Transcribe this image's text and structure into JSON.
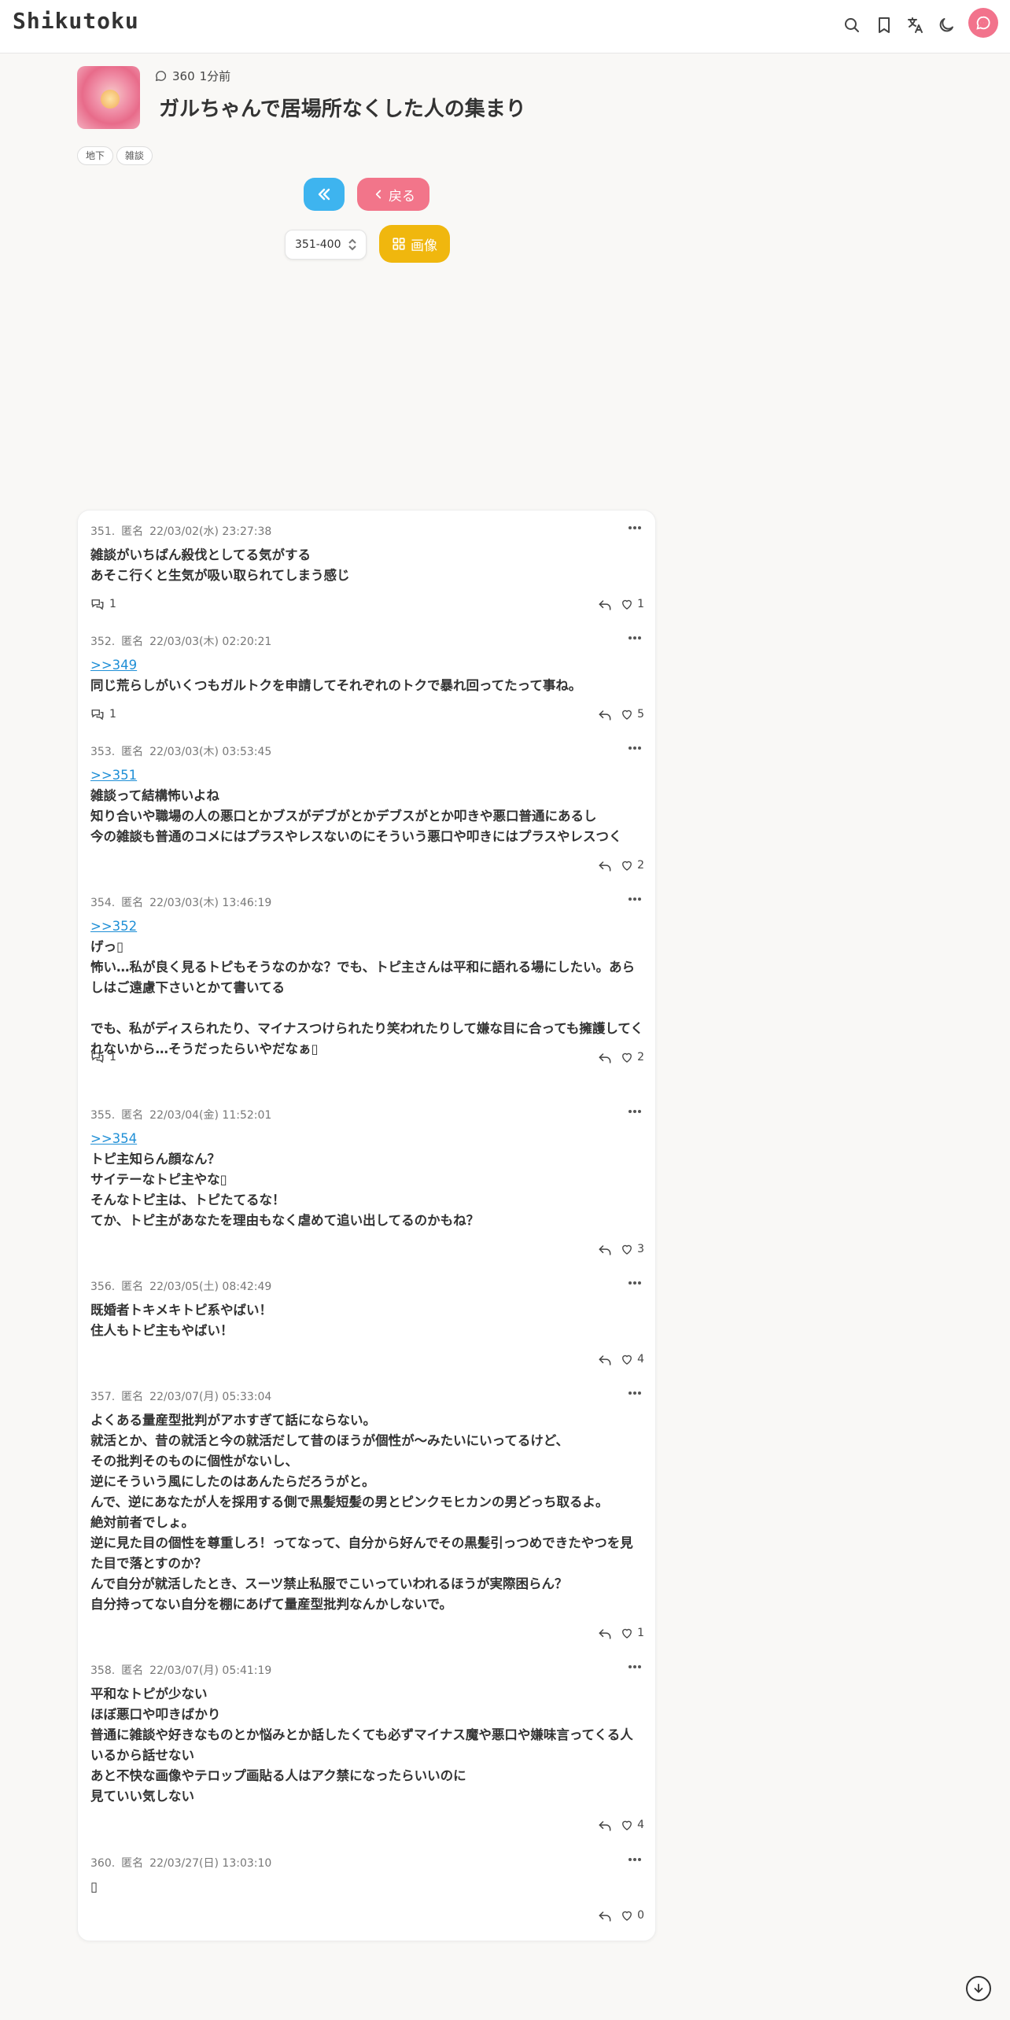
{
  "header": {
    "logo": "Shikutoku",
    "icons": [
      "search-icon",
      "bookmark-icon",
      "translate-icon",
      "moon-icon",
      "chat-icon"
    ]
  },
  "topic": {
    "comment_count": "360",
    "time_ago": "1分前",
    "title": "ガルちゃんで居場所なくした人の集まり",
    "tags": [
      "地下",
      "雑談"
    ]
  },
  "nav": {
    "back_label": "戻る",
    "page_range": "351-400",
    "image_label": "画像"
  },
  "colors": {
    "first_button": "#3eb4ef",
    "back_button": "#f2758a",
    "image_button": "#f0b70e",
    "link": "#1f8fd6"
  },
  "posts": [
    {
      "num": "351.",
      "name": "匿名",
      "date": "22/03/02(水) 23:27:38",
      "lines": [
        "雑談がいちばん殺伐としてる気がする",
        "あそこ行くと生気が吸い取られてしまう感じ"
      ],
      "reply_count": "1",
      "likes": "1"
    },
    {
      "num": "352.",
      "name": "匿名",
      "date": "22/03/03(木) 02:20:21",
      "reply_to": ">>349",
      "lines": [
        "同じ荒らしがいくつもガルトクを申請してそれぞれのトクで暴れ回ってたって事ね。"
      ],
      "reply_count": "1",
      "likes": "5"
    },
    {
      "num": "353.",
      "name": "匿名",
      "date": "22/03/03(木) 03:53:45",
      "reply_to": ">>351",
      "lines": [
        "雑談って結構怖いよね",
        "知り合いや職場の人の悪口とかブスがデブがとかデブスがとか叩きや悪口普通にあるし",
        "今の雑談も普通のコメにはプラスやレスないのにそういう悪口や叩きにはプラスやレスつく"
      ],
      "likes": "2"
    },
    {
      "num": "354.",
      "name": "匿名",
      "date": "22/03/03(木) 13:46:19",
      "reply_to": ">>352",
      "lines": [
        "げっ▯",
        "怖い…私が良く見るトピもそうなのかな？でも、トピ主さんは平和に語れる場にしたい。あらしはご遠慮下さいとかて書いてる",
        "",
        "でも、私がディスられたり、マイナスつけられたり笑われたりして嫌な目に合っても擁護してくれないから…そうだったらいやだなぁ▯"
      ],
      "reply_count": "1",
      "likes": "2"
    },
    {
      "num": "355.",
      "name": "匿名",
      "date": "22/03/04(金) 11:52:01",
      "reply_to": ">>354",
      "lines": [
        "トピ主知らん顔なん？",
        "サイテーなトピ主やな▯",
        "そんなトピ主は、トピたてるな！",
        "てか、トピ主があなたを理由もなく虐めて追い出してるのかもね？"
      ],
      "likes": "3"
    },
    {
      "num": "356.",
      "name": "匿名",
      "date": "22/03/05(土) 08:42:49",
      "lines": [
        "既婚者トキメキトピ系やばい！",
        "住人もトピ主もやばい！"
      ],
      "likes": "4"
    },
    {
      "num": "357.",
      "name": "匿名",
      "date": "22/03/07(月) 05:33:04",
      "lines": [
        "よくある量産型批判がアホすぎて話にならない。",
        "就活とか、昔の就活と今の就活だして昔のほうが個性が～みたいにいってるけど、",
        "その批判そのものに個性がないし、",
        "逆にそういう風にしたのはあんたらだろうがと。",
        "んで、逆にあなたが人を採用する側で黒髪短髪の男とピンクモヒカンの男どっち取るよ。",
        "絶対前者でしょ。",
        "逆に見た目の個性を尊重しろ！ってなって、自分から好んでその黒髪引っつめできたやつを見た目で落とすのか？",
        "んで自分が就活したとき、スーツ禁止私服でこいっていわれるほうが実際困らん？",
        "自分持ってない自分を棚にあげて量産型批判なんかしないで。"
      ],
      "likes": "1"
    },
    {
      "num": "358.",
      "name": "匿名",
      "date": "22/03/07(月) 05:41:19",
      "lines": [
        "平和なトピが少ない",
        "ほぼ悪口や叩きばかり",
        "普通に雑談や好きなものとか悩みとか話したくても必ずマイナス魔や悪口や嫌味言ってくる人いるから話せない",
        "あと不快な画像やテロップ画貼る人はアク禁になったらいいのに",
        "見ていい気しない"
      ],
      "likes": "4"
    },
    {
      "num": "360.",
      "name": "匿名",
      "date": "22/03/27(日) 13:03:10",
      "lines": [
        "▯"
      ],
      "likes": "0"
    }
  ]
}
